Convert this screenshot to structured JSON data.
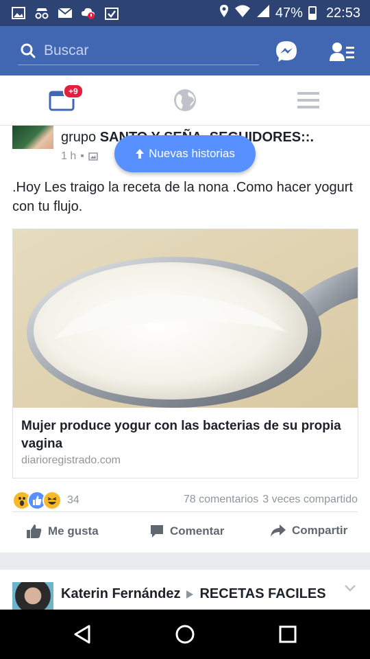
{
  "status_bar": {
    "battery": "47%",
    "time": "22:53"
  },
  "header": {
    "search_placeholder": "Buscar",
    "messenger_icon": "messenger-icon",
    "friends_icon": "friend-requests-icon"
  },
  "tabs": {
    "notifications_badge": "+9"
  },
  "post": {
    "group_prefix": "grupo",
    "group_name": "SANTO Y SEÑA, SEGUIDORES::.",
    "time": "1 h",
    "new_stories": "Nuevas historias",
    "text": ".Hoy Les traigo la receta de la nona .Como hacer yogurt con tu flujo.",
    "link_title": "Mujer produce yogur con las bacterias de su propia vagina",
    "link_domain": "diarioregistrado.com",
    "reactions_count": "34",
    "comments": "78 comentarios",
    "shares": "3 veces compartido",
    "like_label": "Me gusta",
    "comment_label": "Comentar",
    "share_label": "Compartir"
  },
  "post2": {
    "author": "Katerin Fernández",
    "group": "RECETAS FACILES"
  },
  "colors": {
    "header": "#4267b2",
    "statusbar": "#2d4373",
    "pill": "#5890ff",
    "badge": "#e41e3f"
  }
}
